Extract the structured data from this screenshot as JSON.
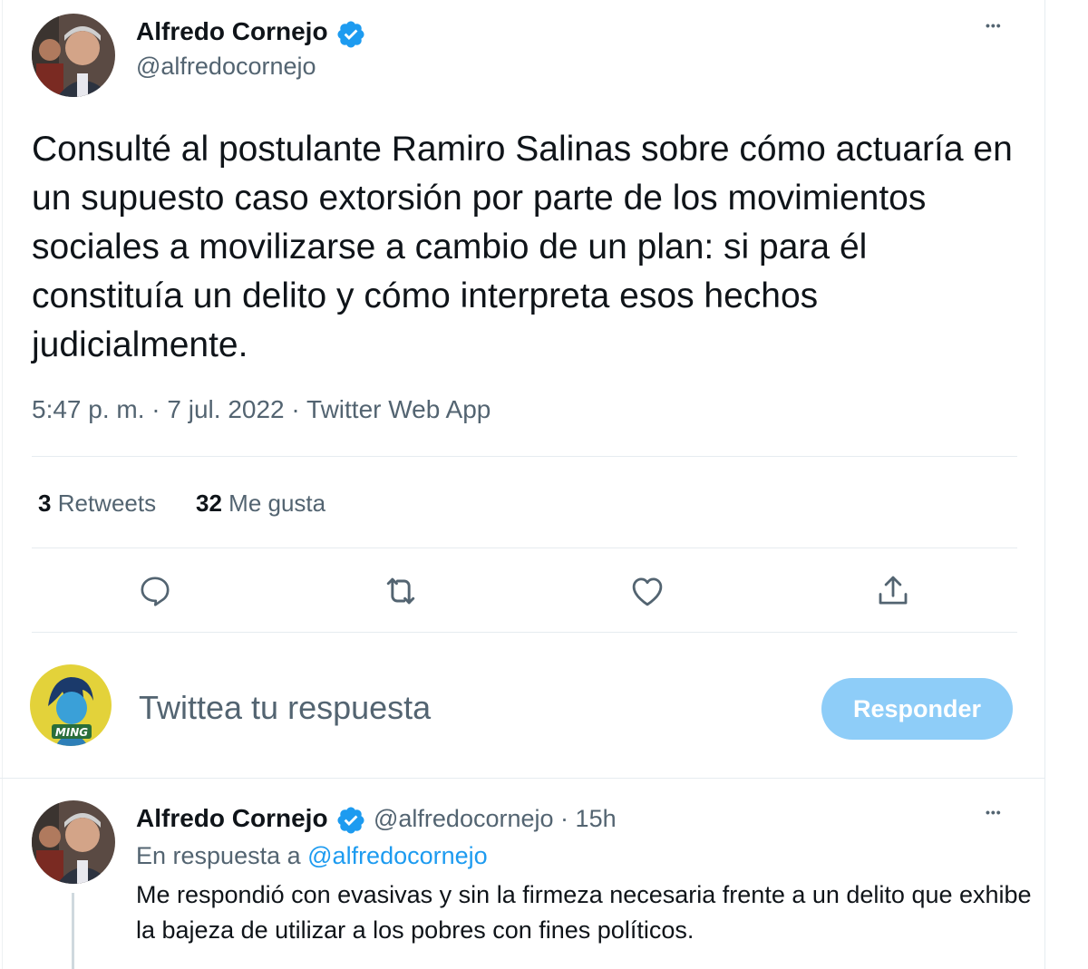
{
  "tweet": {
    "author_name": "Alfredo Cornejo",
    "author_handle": "@alfredocornejo",
    "more_label": "•••",
    "text": "Consulté al postulante Ramiro Salinas sobre cómo actuaría en un supuesto caso extorsión por parte de los movimientos sociales a movilizarse a cambio de un plan: si para él constituía un delito y cómo interpreta esos hechos judicialmente.",
    "time": "5:47 p. m.",
    "date": "7 jul. 2022",
    "source": "Twitter Web App",
    "retweets_count": "3",
    "retweets_label": "Retweets",
    "likes_count": "32",
    "likes_label": "Me gusta"
  },
  "actions": {
    "reply_icon": "reply-bubble-icon",
    "retweet_icon": "retweet-icon",
    "like_icon": "heart-icon",
    "share_icon": "share-icon"
  },
  "composer": {
    "placeholder": "Twittea tu respuesta",
    "button_label": "Responder",
    "avatar_text": "MING"
  },
  "reply": {
    "author_name": "Alfredo Cornejo",
    "author_handle": "@alfredocornejo",
    "age": "15h",
    "more_label": "•••",
    "in_reply_prefix": "En respuesta a",
    "in_reply_mention": "@alfredocornejo",
    "text": "Me respondió con evasivas y sin la firmeza necesaria frente a un delito que exhibe la bajeza de utilizar a los pobres con fines políticos."
  },
  "colors": {
    "accent": "#1d9bf0",
    "button_disabled": "#8ecdf8",
    "secondary_text": "#536471"
  }
}
